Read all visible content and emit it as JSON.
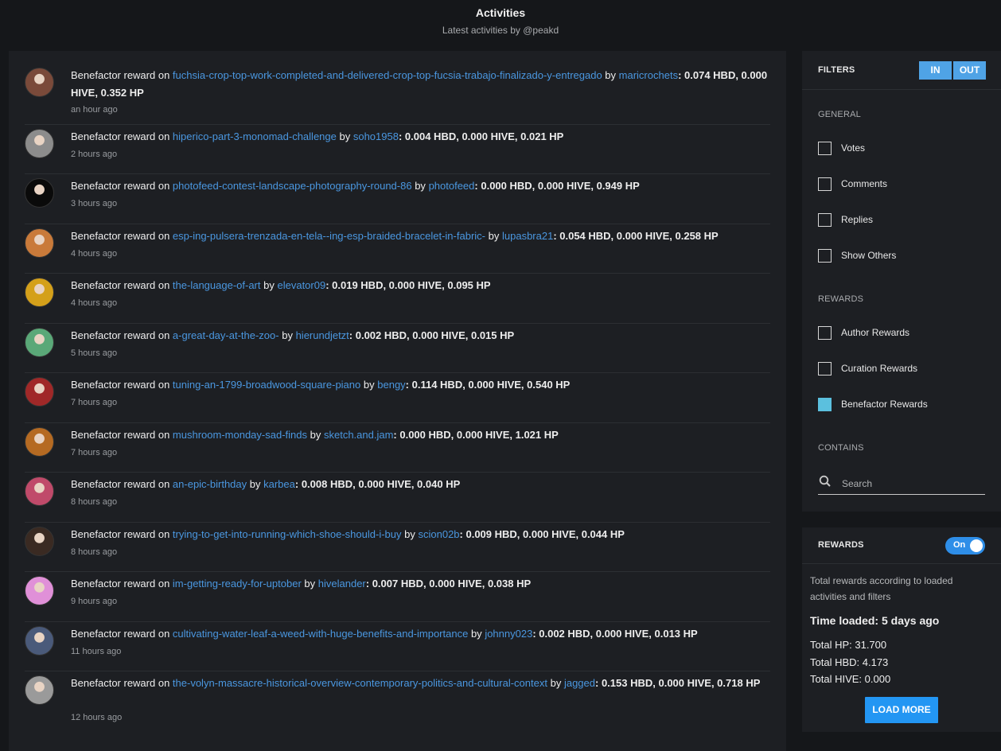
{
  "header": {
    "title": "Activities",
    "subtitle": "Latest activities by @peakd"
  },
  "feed": {
    "prefix": "Benefactor reward on",
    "by": "by",
    "items": [
      {
        "post": "fuchsia-crop-top-work-completed-and-delivered-crop-top-fucsia-trabajo-finalizado-y-entregado",
        "author": "maricrochets",
        "amount": ": 0.074 HBD, 0.000 HIVE, 0.352 HP",
        "time": "an hour ago",
        "avatar_color": "#7a4a3a"
      },
      {
        "post": "hiperico-part-3-monomad-challenge",
        "author": "soho1958",
        "amount": ": 0.004 HBD, 0.000 HIVE, 0.021 HP",
        "time": "2 hours ago",
        "avatar_color": "#8c8c8c"
      },
      {
        "post": "photofeed-contest-landscape-photography-round-86",
        "author": "photofeed",
        "amount": ": 0.000 HBD, 0.000 HIVE, 0.949 HP",
        "time": "3 hours ago",
        "avatar_color": "#0a0a0a"
      },
      {
        "post": "esp-ing-pulsera-trenzada-en-tela--ing-esp-braided-bracelet-in-fabric-",
        "author": "lupasbra21",
        "amount": ": 0.054 HBD, 0.000 HIVE, 0.258 HP",
        "time": "4 hours ago",
        "avatar_color": "#c97a3a"
      },
      {
        "post": "the-language-of-art",
        "author": "elevator09",
        "amount": ": 0.019 HBD, 0.000 HIVE, 0.095 HP",
        "time": "4 hours ago",
        "avatar_color": "#d4a01a"
      },
      {
        "post": "a-great-day-at-the-zoo-",
        "author": "hierundjetzt",
        "amount": ": 0.002 HBD, 0.000 HIVE, 0.015 HP",
        "time": "5 hours ago",
        "avatar_color": "#5aa878"
      },
      {
        "post": "tuning-an-1799-broadwood-square-piano",
        "author": "bengy",
        "amount": ": 0.114 HBD, 0.000 HIVE, 0.540 HP",
        "time": "7 hours ago",
        "avatar_color": "#a02828"
      },
      {
        "post": "mushroom-monday-sad-finds",
        "author": "sketch.and.jam",
        "amount": ": 0.000 HBD, 0.000 HIVE, 1.021 HP",
        "time": "7 hours ago",
        "avatar_color": "#b56a22"
      },
      {
        "post": "an-epic-birthday",
        "author": "karbea",
        "amount": ": 0.008 HBD, 0.000 HIVE, 0.040 HP",
        "time": "8 hours ago",
        "avatar_color": "#c04a6a"
      },
      {
        "post": "trying-to-get-into-running-which-shoe-should-i-buy",
        "author": "scion02b",
        "amount": ": 0.009 HBD, 0.000 HIVE, 0.044 HP",
        "time": "8 hours ago",
        "avatar_color": "#3a2a22"
      },
      {
        "post": "im-getting-ready-for-uptober",
        "author": "hivelander",
        "amount": ": 0.007 HBD, 0.000 HIVE, 0.038 HP",
        "time": "9 hours ago",
        "avatar_color": "#e090d8"
      },
      {
        "post": "cultivating-water-leaf-a-weed-with-huge-benefits-and-importance",
        "author": "johnny023",
        "amount": ": 0.002 HBD, 0.000 HIVE, 0.013 HP",
        "time": "11 hours ago",
        "avatar_color": "#4a5a7a"
      },
      {
        "post": "the-volyn-massacre-historical-overview-contemporary-politics-and-cultural-context",
        "author": "jagged",
        "amount": ": 0.153 HBD, 0.000 HIVE, 0.718 HP",
        "time": "12 hours ago",
        "avatar_color": "#9a9a9a"
      }
    ]
  },
  "filters": {
    "title": "FILTERS",
    "in_label": "IN",
    "out_label": "OUT",
    "general_title": "GENERAL",
    "general": [
      {
        "label": "Votes",
        "checked": false
      },
      {
        "label": "Comments",
        "checked": false
      },
      {
        "label": "Replies",
        "checked": false
      },
      {
        "label": "Show Others",
        "checked": false
      }
    ],
    "rewards_title": "REWARDS",
    "rewards": [
      {
        "label": "Author Rewards",
        "checked": false
      },
      {
        "label": "Curation Rewards",
        "checked": false
      },
      {
        "label": "Benefactor Rewards",
        "checked": true
      }
    ],
    "contains_title": "CONTAINS",
    "search_placeholder": "Search"
  },
  "rewards_panel": {
    "title": "REWARDS",
    "switch_label": "On",
    "description": "Total rewards according to loaded activities and filters",
    "time_loaded": "Time loaded: 5 days ago",
    "total_hp": "Total HP: 31.700",
    "total_hbd": "Total HBD: 4.173",
    "total_hive": "Total HIVE: 0.000",
    "load_more": "LOAD MORE"
  }
}
